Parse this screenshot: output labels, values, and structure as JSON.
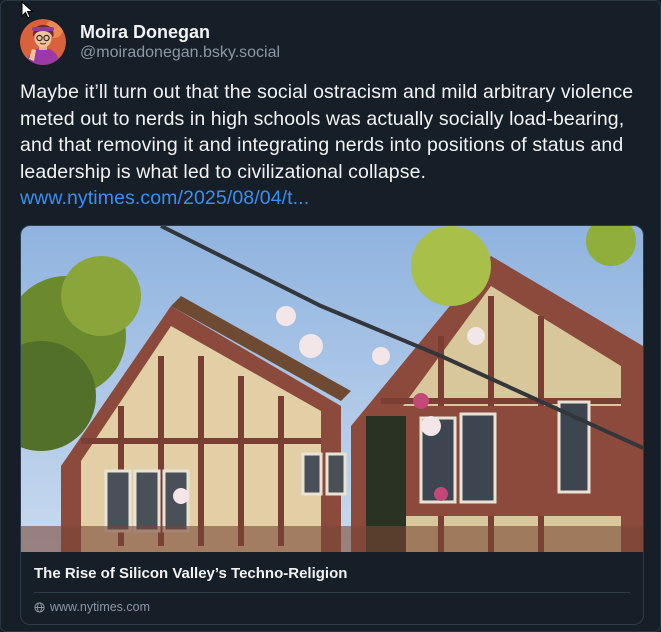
{
  "post": {
    "author": {
      "display_name": "Moira Donegan",
      "handle": "@moiradonegan.bsky.social",
      "avatar_icon": "user-avatar"
    },
    "text": "Maybe it’ll turn out that the social ostracism and mild arbitrary violence meted out to nerds in high schools was actually socially load-bearing, and that removing it and integrating nerds into positions of status and leadership is what led to civilizational collapse. ",
    "link_text": "www.nytimes.com/2025/08/04/t..."
  },
  "link_card": {
    "title": "The Rise of Silicon Valley’s Techno-Religion",
    "domain": "www.nytimes.com",
    "domain_icon": "globe-icon"
  },
  "colors": {
    "background": "#161e27",
    "text": "#f1f3f5",
    "muted": "#8b98a5",
    "link": "#3b8ff0",
    "border": "#2e3b4a"
  }
}
